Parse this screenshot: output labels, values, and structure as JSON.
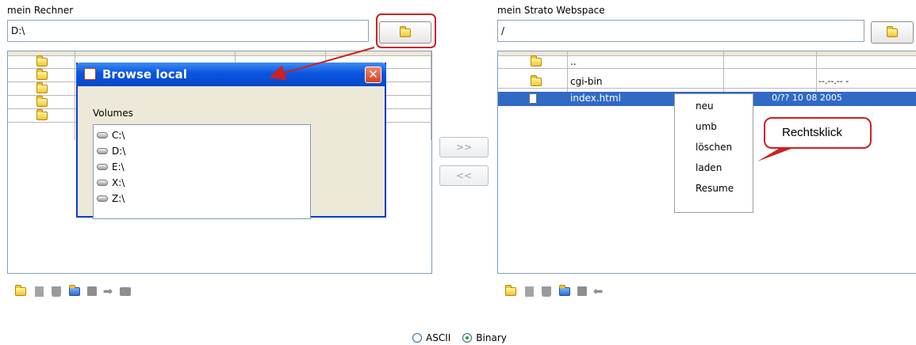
{
  "left": {
    "title": "mein Rechner",
    "path": "D:\\",
    "rows": 5,
    "toolbar_icons": [
      "new-folder-icon",
      "file-icon",
      "trash-icon",
      "refresh-icon",
      "stop-icon",
      "upload-arrow-icon",
      "computer-icon"
    ]
  },
  "right": {
    "title": "mein Strato Webspace",
    "path": "/",
    "rows": [
      {
        "icon": "folder-icon",
        "name": "..",
        "date": ""
      },
      {
        "icon": "folder-icon",
        "name": "cgi-bin",
        "date": "--.--.-- -"
      },
      {
        "icon": "file-icon",
        "name": "index.html",
        "date": "0/?? 10 08 2005"
      }
    ],
    "toolbar_icons": [
      "new-folder-icon",
      "file-icon",
      "trash-icon",
      "refresh-icon",
      "stop-icon",
      "download-arrow-icon"
    ]
  },
  "transfer": {
    "to_right": ">>",
    "to_left": "<<"
  },
  "dialog": {
    "title": "Browse local",
    "close": "✕",
    "section": "Volumes",
    "volumes": [
      "C:\\",
      "D:\\",
      "E:\\",
      "X:\\",
      "Z:\\"
    ]
  },
  "context_menu": {
    "items": [
      "neu",
      "umb",
      "löschen",
      "laden",
      "Resume"
    ]
  },
  "annotation": {
    "callout": "Rechtsklick",
    "accent": "#d02020"
  },
  "mode": {
    "ascii": "ASCII",
    "binary": "Binary",
    "selected": "binary"
  }
}
